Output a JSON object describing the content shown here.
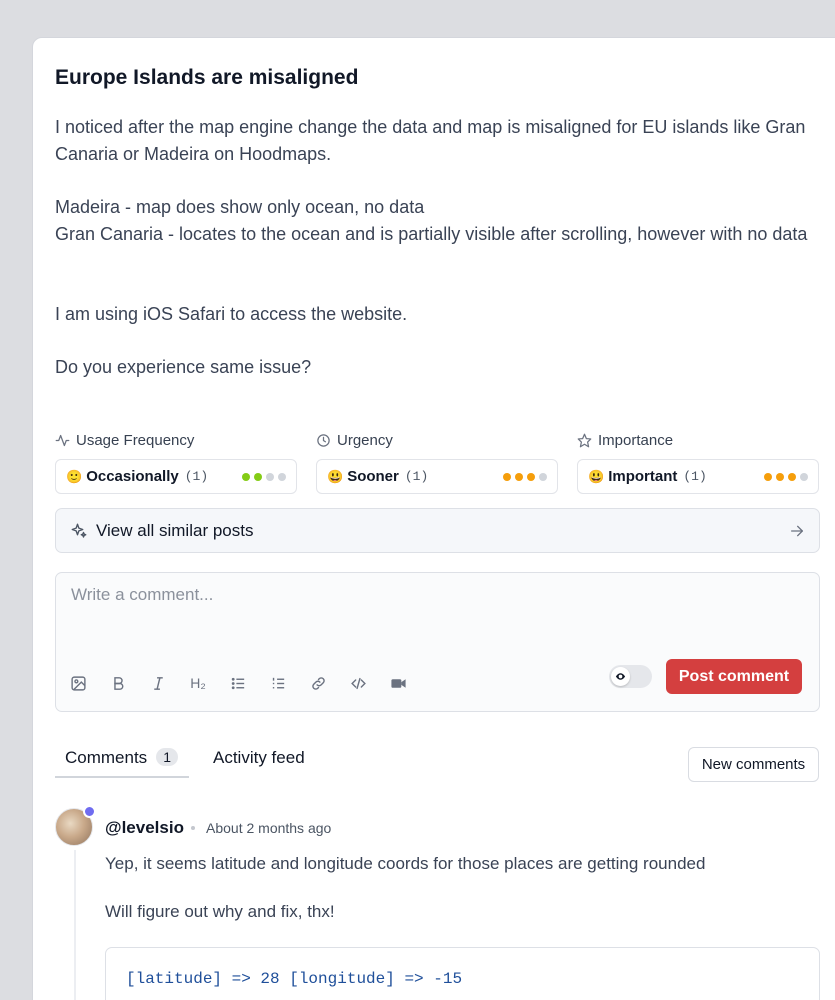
{
  "post": {
    "title": "Europe Islands are misaligned",
    "paragraphs": [
      "I noticed after the map engine change the data and map is misaligned for EU islands like Gran Canaria or Madeira on Hoodmaps.",
      "Madeira - map does show only ocean, no data\nGran Canaria - locates to the ocean and is partially visible after scrolling, however with no data",
      "I am using iOS Safari to access the website.",
      "Do you experience same issue?"
    ]
  },
  "feedback": [
    {
      "label": "Usage Frequency",
      "icon": "activity-icon",
      "emoji": "🙂",
      "value": "Occasionally",
      "count": "(1)",
      "level": 2,
      "total": 4,
      "color": "#84cc16"
    },
    {
      "label": "Urgency",
      "icon": "clock-icon",
      "emoji": "😃",
      "value": "Sooner",
      "count": "(1)",
      "level": 3,
      "total": 4,
      "color": "#f59e0b"
    },
    {
      "label": "Importance",
      "icon": "star-icon",
      "emoji": "😃",
      "value": "Important",
      "count": "(1)",
      "level": 3,
      "total": 4,
      "color": "#f59e0b"
    }
  ],
  "similar": {
    "label": "View all similar posts"
  },
  "composer": {
    "placeholder": "Write a comment...",
    "post_label": "Post comment",
    "h2_label": "H₂"
  },
  "tabs": {
    "comments_label": "Comments",
    "comments_count": "1",
    "activity_label": "Activity feed",
    "new_comments_label": "New comments"
  },
  "comment": {
    "author": "@levelsio",
    "time": "About 2 months ago",
    "lines": [
      "Yep, it seems latitude and longitude coords for those places are getting rounded",
      "Will figure out why and fix, thx!"
    ],
    "code": "[latitude] => 28 [longitude] => -15"
  },
  "colors": {
    "accent_red": "#d43f3f",
    "verified": "#6f6cf0",
    "dot_inactive": "#d1d5db"
  }
}
